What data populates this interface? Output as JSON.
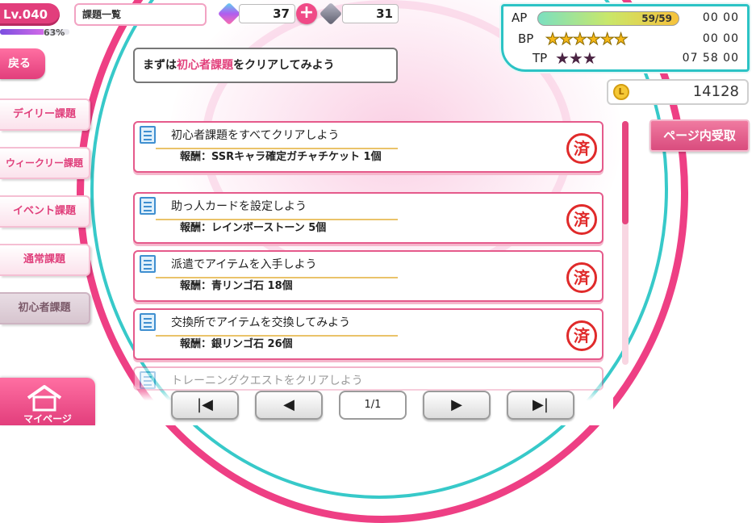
{
  "player": {
    "level_label": "Lv.040",
    "exp_percent": 63,
    "exp_text": "63%"
  },
  "screen_title": "課題一覧",
  "currency": {
    "gems": "37",
    "plus_label": "+",
    "silver_gems": "31",
    "coins": "14128",
    "coin_icon_letter": "L"
  },
  "status": {
    "ap_label": "AP",
    "ap_value": "59/59",
    "ap_time": "00 00",
    "bp_label": "BP",
    "bp_stars": "★★★★★★",
    "bp_time": "00 00",
    "tp_label": "TP",
    "tp_stars": "★★★",
    "tp_time": "07 58 00"
  },
  "back_label": "戻る",
  "tabs": [
    {
      "label": "デイリー課題"
    },
    {
      "label": "ウィークリー課題"
    },
    {
      "label": "イベント課題"
    },
    {
      "label": "通常課題"
    },
    {
      "label": "初心者課題"
    }
  ],
  "active_tab": "初心者課題",
  "header": {
    "prefix": "まずは",
    "highlight": "初心者課題",
    "suffix": "をクリアしてみよう"
  },
  "receive_label": "ページ内受取",
  "missions": [
    {
      "title": "初心者課題をすべてクリアしよう",
      "reward": "報酬：SSRキャラ確定ガチャチケット 1個",
      "stamp": "済"
    },
    {
      "title": "助っ人カードを設定しよう",
      "reward": "報酬：レインボーストーン 5個",
      "stamp": "済"
    },
    {
      "title": "派遣でアイテムを入手しよう",
      "reward": "報酬：青リンゴ石 18個",
      "stamp": "済"
    },
    {
      "title": "交換所でアイテムを交換してみよう",
      "reward": "報酬：銀リンゴ石 26個",
      "stamp": "済"
    },
    {
      "title": "トレーニングクエストをクリアしよう"
    }
  ],
  "pager": {
    "first": "|◀",
    "prev": "◀",
    "page": "1/1",
    "next": "▶",
    "last": "▶|"
  },
  "mypage_label": "マイページ",
  "colors": {
    "accent": "#e23e7c",
    "teal": "#2cc3c5",
    "stamp_red": "#e02a2a"
  }
}
